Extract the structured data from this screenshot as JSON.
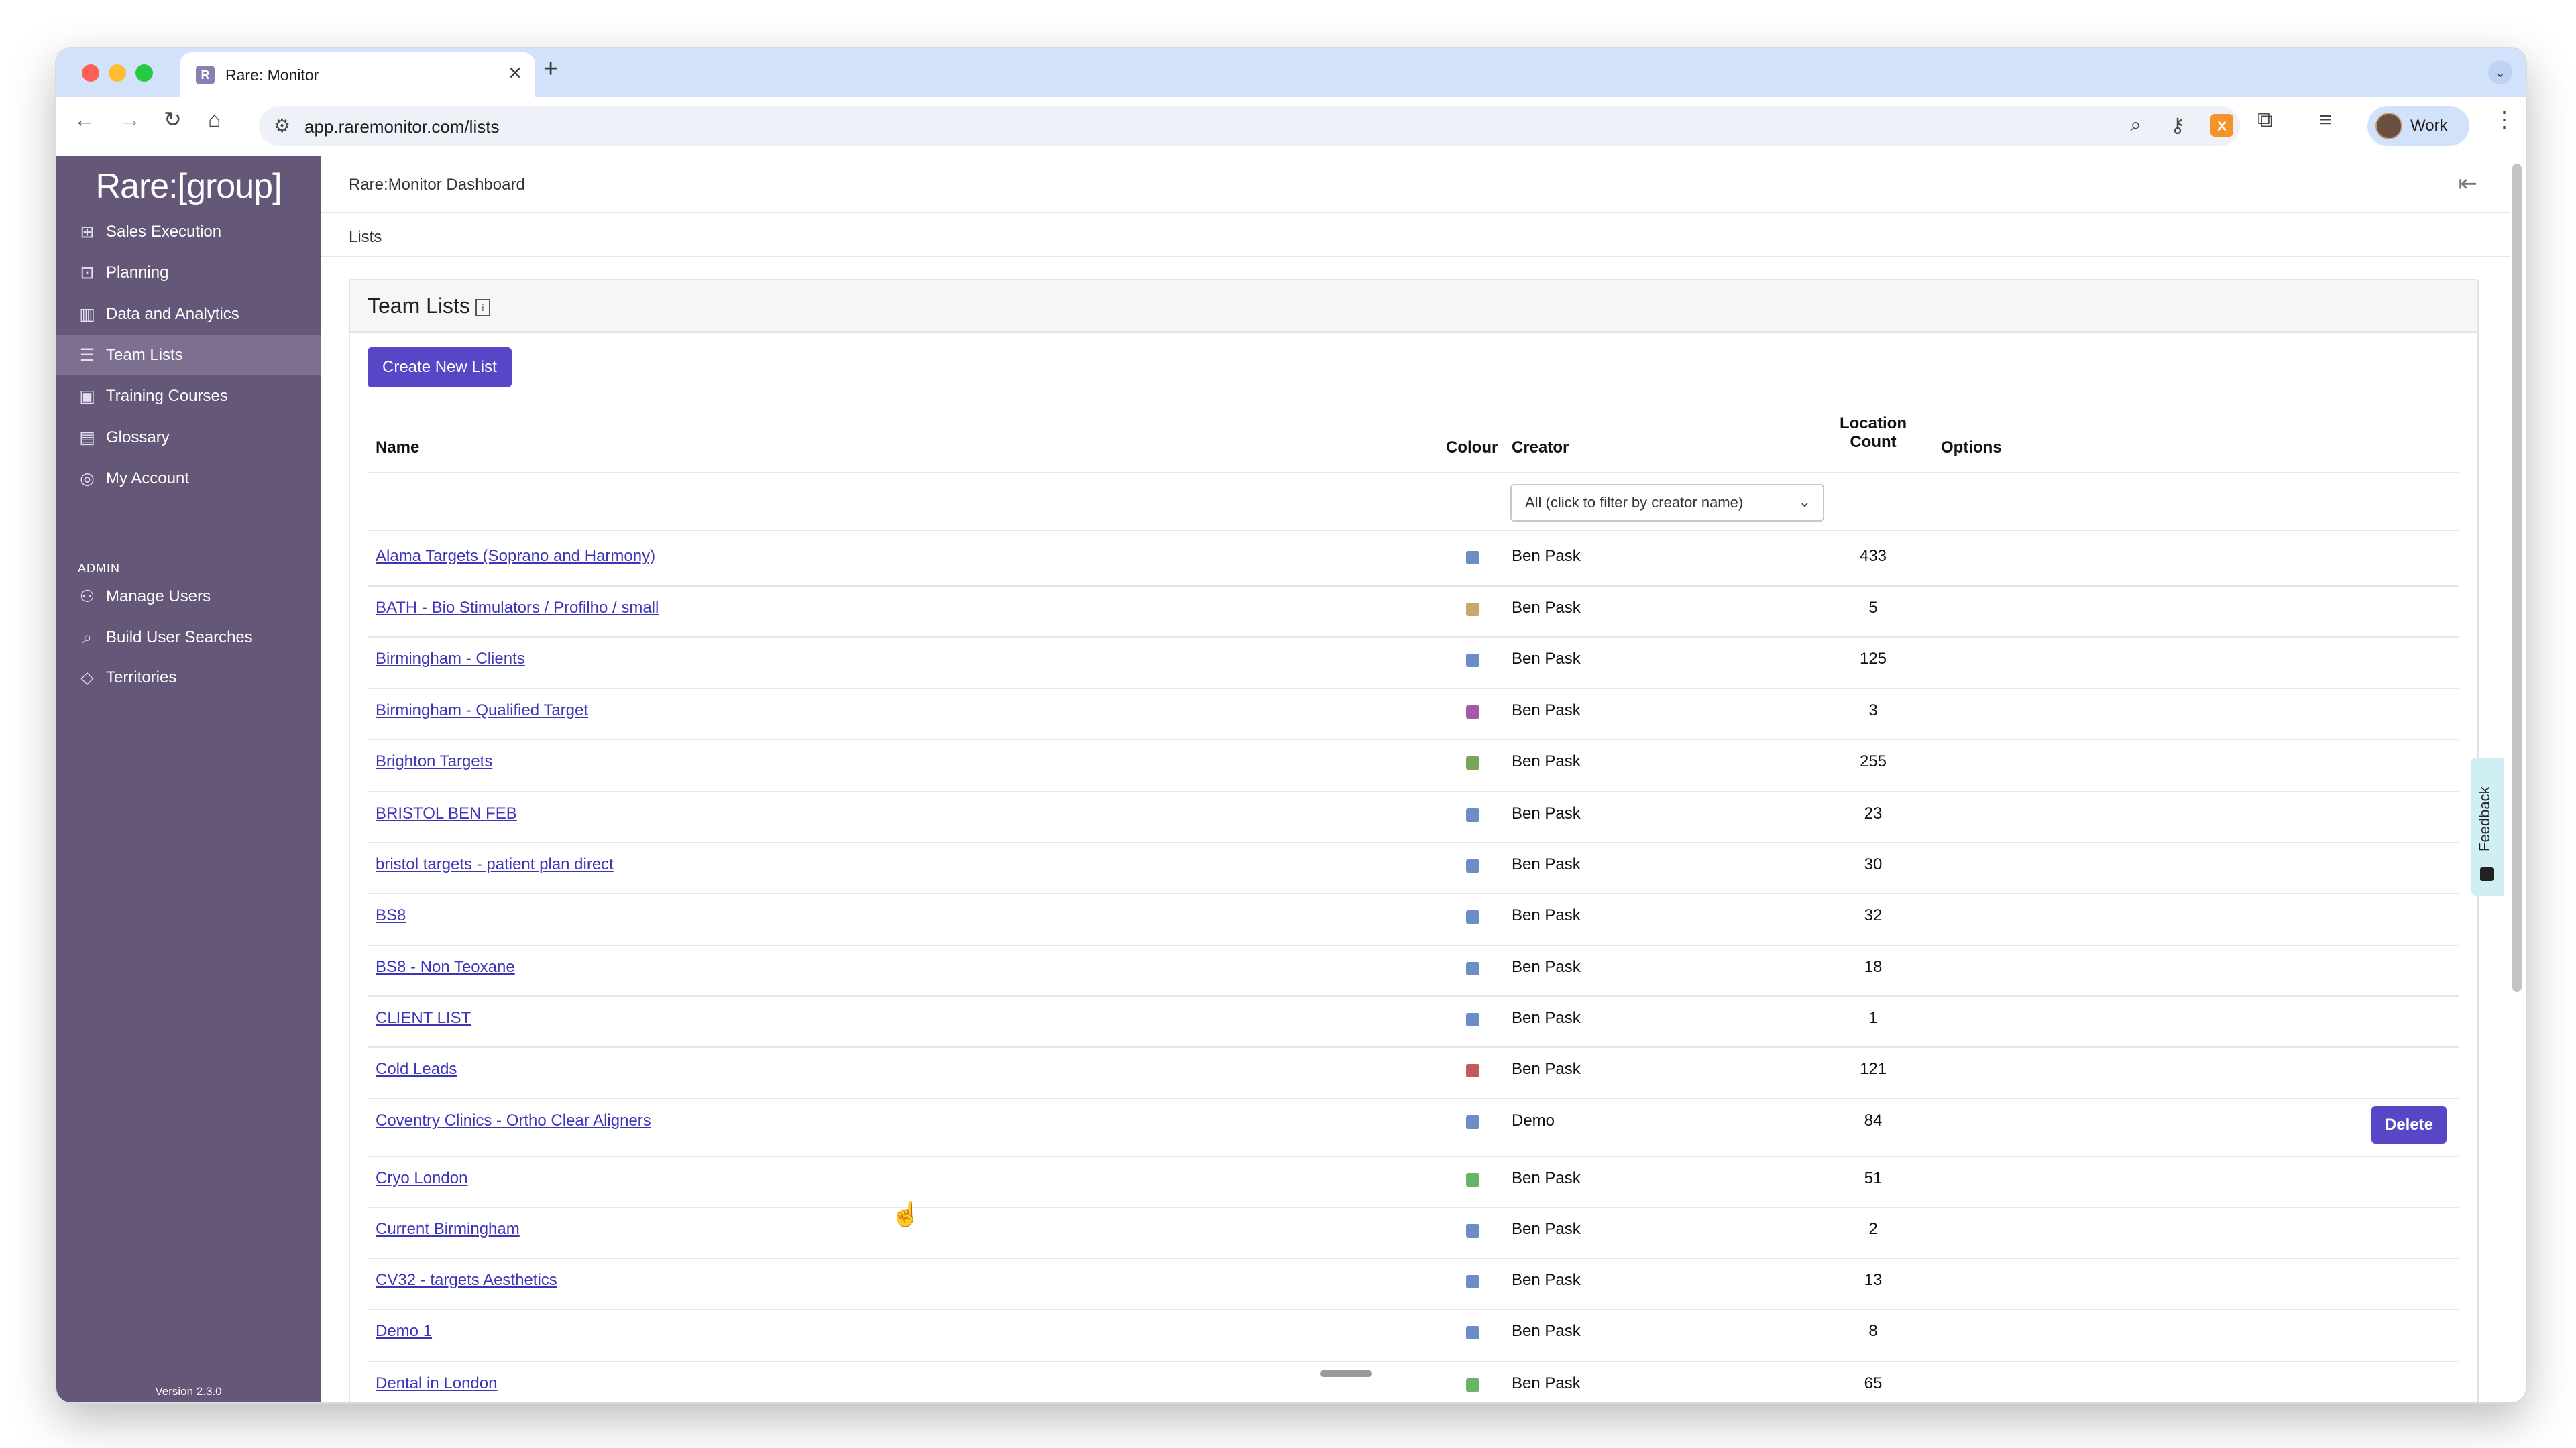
{
  "browser": {
    "tab_title": "Rare: Monitor",
    "tab_favicon": "R",
    "new_tab_glyph": "+",
    "url": "app.raremonitor.com/lists",
    "profile_label": "Work",
    "icons": [
      "back-icon",
      "forward-icon",
      "reload-icon",
      "home-icon",
      "site-settings-icon",
      "zoom-icon",
      "password-key-icon",
      "bookmark-star-icon",
      "extension-orange-icon",
      "extensions-puzzle-icon",
      "media-control-icon",
      "kebab-menu-icon"
    ]
  },
  "sidebar": {
    "logo": "Rare:[group]",
    "items": [
      {
        "label": "Sales Execution",
        "icon": "dashboard-icon"
      },
      {
        "label": "Planning",
        "icon": "planning-icon"
      },
      {
        "label": "Data and Analytics",
        "icon": "bar-chart-icon"
      },
      {
        "label": "Team Lists",
        "icon": "list-icon",
        "active": true
      },
      {
        "label": "Training Courses",
        "icon": "training-icon"
      },
      {
        "label": "Glossary",
        "icon": "book-icon"
      },
      {
        "label": "My Account",
        "icon": "account-icon"
      }
    ],
    "admin_label": "ADMIN",
    "admin_items": [
      {
        "label": "Manage Users",
        "icon": "users-icon"
      },
      {
        "label": "Build User Searches",
        "icon": "search-icon"
      },
      {
        "label": "Territories",
        "icon": "territory-tag-icon"
      }
    ],
    "version": "Version 2.3.0"
  },
  "main": {
    "dashboard_title": "Rare:Monitor Dashboard",
    "breadcrumb": "Lists",
    "card_title": "Team Lists",
    "info_glyph": "i",
    "create_button": "Create New List",
    "columns": {
      "name": "Name",
      "colour": "Colour",
      "creator": "Creator",
      "location_count_line1": "Location",
      "location_count_line2": "Count",
      "options": "Options"
    },
    "creator_filter": "All (click to filter by creator name)",
    "delete_label": "Delete",
    "feedback_label": "Feedback",
    "rows": [
      {
        "name": "Alama Targets (Soprano and Harmony)",
        "colour": "#6b8fc4",
        "creator": "Ben Pask",
        "count": "433"
      },
      {
        "name": "BATH - Bio Stimulators / Profilho / small",
        "colour": "#c9a86a",
        "creator": "Ben Pask",
        "count": "5"
      },
      {
        "name": "Birmingham - Clients",
        "colour": "#6b8fc4",
        "creator": "Ben Pask",
        "count": "125"
      },
      {
        "name": "Birmingham - Qualified Target",
        "colour": "#a55aa5",
        "creator": "Ben Pask",
        "count": "3"
      },
      {
        "name": "Brighton Targets",
        "colour": "#76a65a",
        "creator": "Ben Pask",
        "count": "255"
      },
      {
        "name": "BRISTOL BEN FEB",
        "colour": "#6b8fc4",
        "creator": "Ben Pask",
        "count": "23"
      },
      {
        "name": "bristol targets - patient plan direct",
        "colour": "#6b8fc4",
        "creator": "Ben Pask",
        "count": "30"
      },
      {
        "name": "BS8",
        "colour": "#6b8fc4",
        "creator": "Ben Pask",
        "count": "32"
      },
      {
        "name": "BS8 - Non Teoxane",
        "colour": "#6b8fc4",
        "creator": "Ben Pask",
        "count": "18"
      },
      {
        "name": "CLIENT LIST",
        "colour": "#6b8fc4",
        "creator": "Ben Pask",
        "count": "1"
      },
      {
        "name": "Cold Leads",
        "colour": "#c45a5a",
        "creator": "Ben Pask",
        "count": "121"
      },
      {
        "name": "Coventry Clinics - Ortho Clear Aligners",
        "colour": "#6b8fc4",
        "creator": "Demo",
        "count": "84",
        "deletable": true
      },
      {
        "name": "Cryo London",
        "colour": "#6ab46a",
        "creator": "Ben Pask",
        "count": "51"
      },
      {
        "name": "Current Birmingham",
        "colour": "#6b8fc4",
        "creator": "Ben Pask",
        "count": "2"
      },
      {
        "name": "CV32 - targets Aesthetics",
        "colour": "#6b8fc4",
        "creator": "Ben Pask",
        "count": "13"
      },
      {
        "name": "Demo 1",
        "colour": "#6b8fc4",
        "creator": "Ben Pask",
        "count": "8"
      },
      {
        "name": "Dental in London",
        "colour": "#6ab46a",
        "creator": "Ben Pask",
        "count": "65"
      }
    ]
  }
}
